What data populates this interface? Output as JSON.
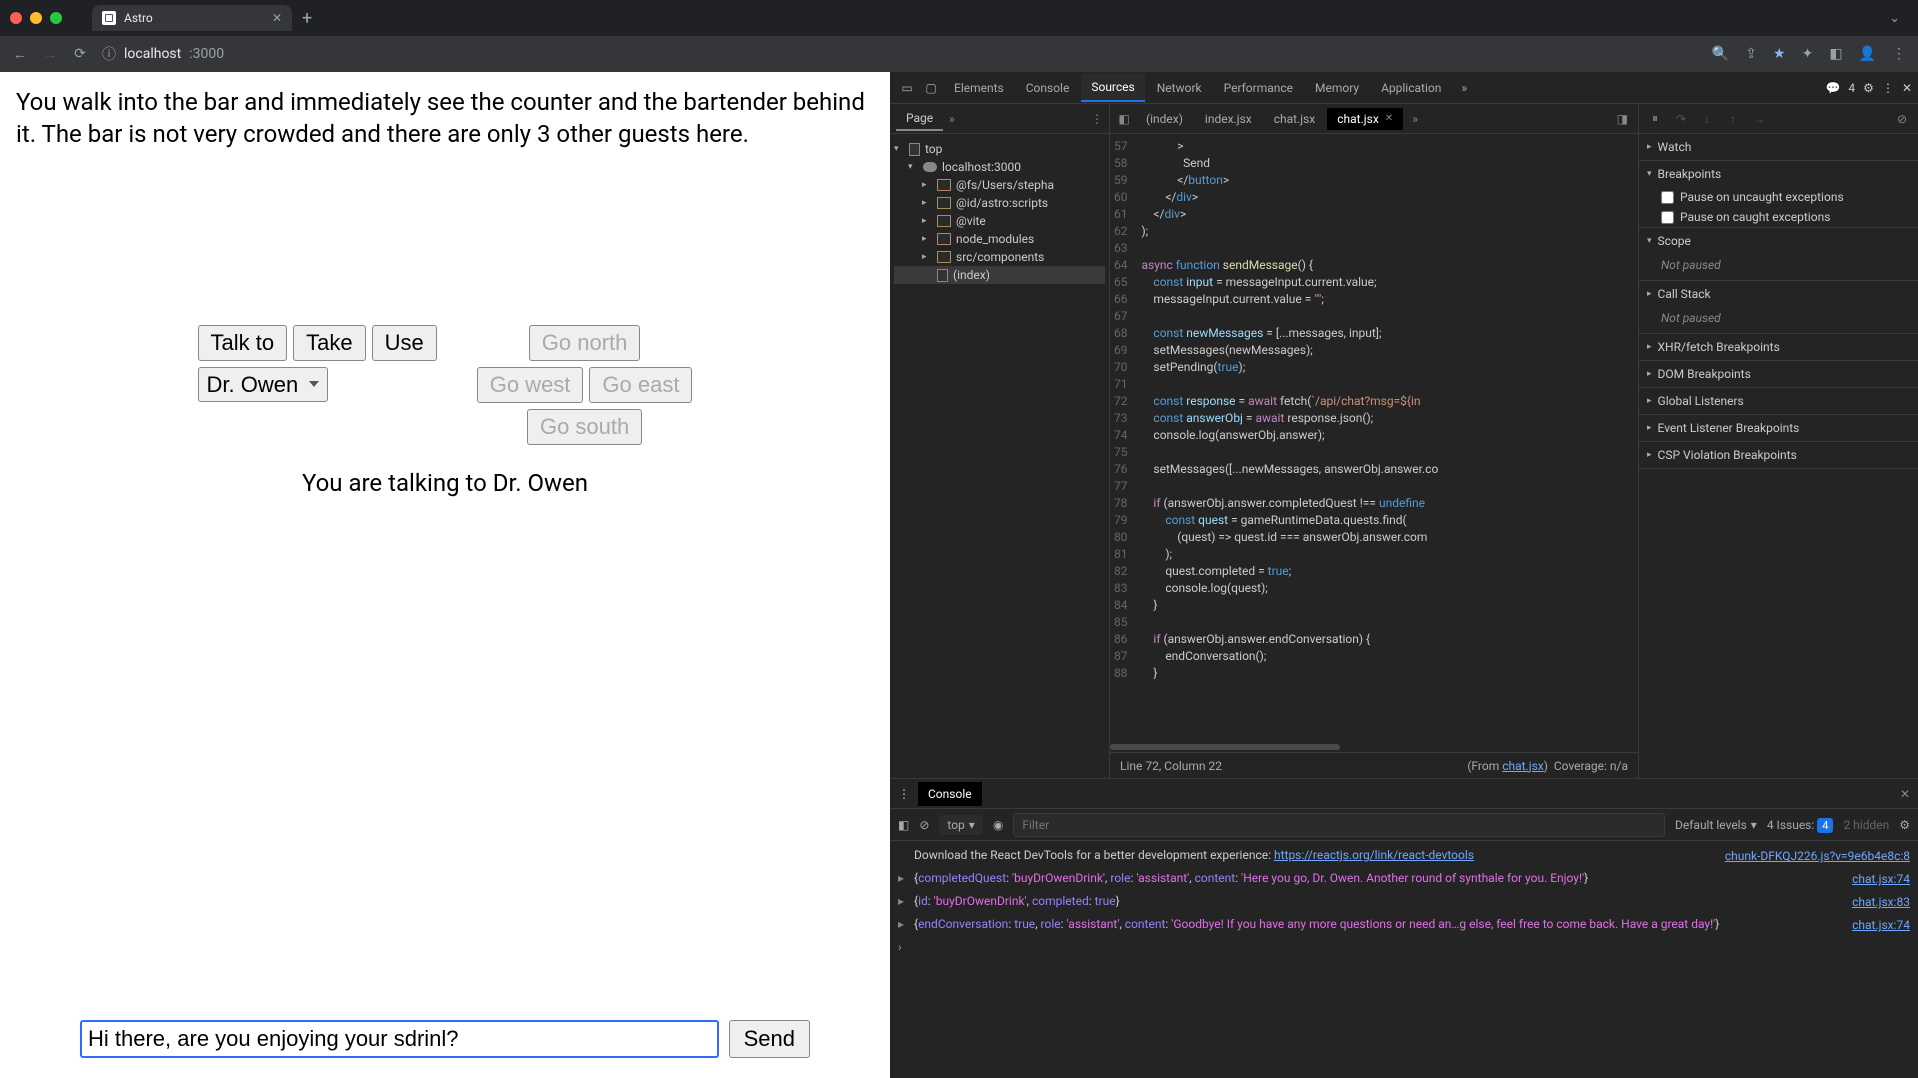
{
  "browser": {
    "tab_title": "Astro",
    "url_host": "localhost",
    "url_rest": ":3000"
  },
  "game": {
    "narration": "You walk into the bar and immediately see the counter and the bartender behind it. The bar is not very crowded and there are only 3 other guests here.",
    "talk_label": "Talk to",
    "talk_target": "Dr. Owen",
    "take_label": "Take",
    "use_label": "Use",
    "north": "Go north",
    "south": "Go south",
    "east": "Go east",
    "west": "Go west",
    "status": "You are talking to Dr. Owen",
    "input_value": "Hi there, are you enjoying your sdrinl?",
    "send": "Send"
  },
  "devtools": {
    "tabs": [
      "Elements",
      "Console",
      "Sources",
      "Network",
      "Performance",
      "Memory",
      "Application"
    ],
    "active_tab": "Sources",
    "issues_count": "4",
    "file_tree": {
      "page_tab": "Page",
      "top": "top",
      "host": "localhost:3000",
      "children": [
        "@fs/Users/stepha",
        "@id/astro:scripts",
        "@vite",
        "node_modules",
        "src/components"
      ],
      "open_file": "(index)"
    },
    "editor": {
      "tabs": [
        "(index)",
        "index.jsx",
        "chat.jsx",
        "chat.jsx"
      ],
      "active_tab": "chat.jsx",
      "lines": [
        57,
        58,
        59,
        60,
        61,
        62,
        63,
        64,
        65,
        66,
        67,
        68,
        69,
        70,
        71,
        72,
        73,
        74,
        75,
        76,
        77,
        78,
        79,
        80,
        81,
        82,
        83,
        84,
        85,
        86,
        87,
        88
      ],
      "status_line": "Line 72, Column 22",
      "from_label": "(From ",
      "from_file": "chat.jsx",
      "coverage": "Coverage: n/a"
    },
    "debugger": {
      "watch": "Watch",
      "breakpoints": "Breakpoints",
      "pause_uncaught": "Pause on uncaught exceptions",
      "pause_caught": "Pause on caught exceptions",
      "scope": "Scope",
      "not_paused": "Not paused",
      "call_stack": "Call Stack",
      "xhr": "XHR/fetch Breakpoints",
      "dom": "DOM Breakpoints",
      "global": "Global Listeners",
      "event": "Event Listener Breakpoints",
      "csp": "CSP Violation Breakpoints"
    },
    "console": {
      "tab": "Console",
      "context": "top",
      "filter_placeholder": "Filter",
      "levels": "Default levels",
      "issues_label": "4 Issues:",
      "issues_badge": "4",
      "hidden": "2 hidden",
      "chunk_src": "chunk-DFKQJ226.js?v=9e6b4e8c:8",
      "react_msg": "Download the React DevTools for a better development experience: ",
      "react_link": "https://reactjs.org/link/react-devtools",
      "entries": [
        {
          "src": "chat.jsx:74",
          "body": "{completedQuest: 'buyDrOwenDrink', role: 'assistant', content: 'Here you go, Dr. Owen. Another round of synthale for you. Enjoy!'}"
        },
        {
          "src": "chat.jsx:83",
          "body": "{id: 'buyDrOwenDrink', completed: true}"
        },
        {
          "src": "chat.jsx:74",
          "body": "{endConversation: true, role: 'assistant', content: 'Goodbye! If you have any more questions or need an…g else, feel free to come back. Have a great day!'}"
        }
      ]
    }
  }
}
